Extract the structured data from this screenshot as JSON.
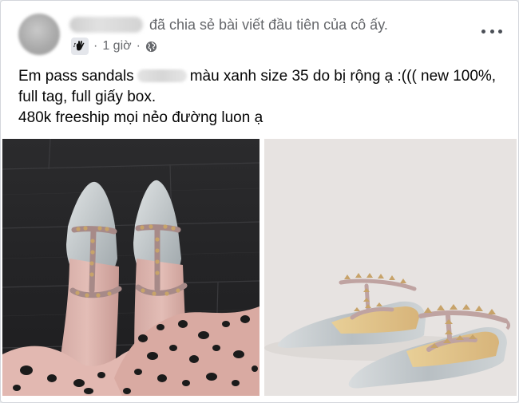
{
  "post": {
    "shared_text": "đã chia sẻ bài viết đầu tiên của cô ấy.",
    "time": "1 giờ",
    "separator": "·",
    "badge_icon": "new-member-wave-icon",
    "privacy_icon": "globe-icon",
    "more_icon": "more-options-icon",
    "body": {
      "part1": "Em pass sandals",
      "part2": "màu xanh size 35 do bị rộng ạ :((( new 100%,",
      "line2": "full tag, full giấy box.",
      "line3": "480k freeship mọi nẻo đường luon ạ"
    }
  },
  "colors": {
    "text_primary": "#050505",
    "text_secondary": "#65676b",
    "shoe_gray": "#c3c9cc",
    "strap_pink": "#b59a98",
    "stud_gold": "#c7a36a"
  }
}
